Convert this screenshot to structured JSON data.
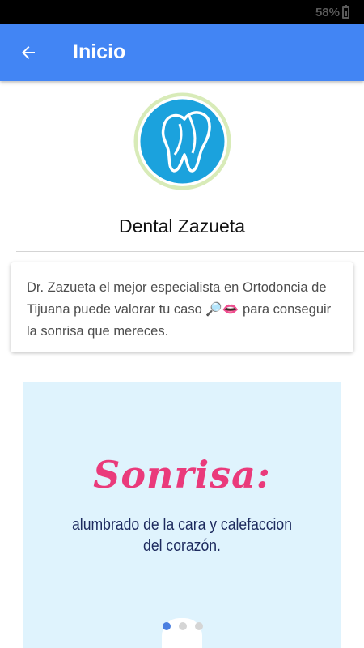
{
  "status_bar": {
    "battery_percent": "58%"
  },
  "app_bar": {
    "title": "Inicio",
    "color": "#4285f4",
    "back_icon": "arrow-left-icon"
  },
  "logo": {
    "icon": "tooth-icon",
    "colors": {
      "outer_ring": "#d8ebb8",
      "fill": "#1ba2dd",
      "tooth": "#ffffff"
    }
  },
  "clinic": {
    "name": "Dental Zazueta"
  },
  "description": {
    "text": "Dr. Zazueta el mejor especialista en Ortodoncia de Tijuana puede valorar tu caso 🔎👄 para conseguir la sonrisa que mereces."
  },
  "carousel": {
    "background": "#dff3fd",
    "slides_total": 3,
    "active_slide": 1,
    "slide": {
      "headline": "Sonrisa:",
      "line1": "alumbrado de la cara y calefaccion",
      "line2": "del corazón."
    }
  }
}
